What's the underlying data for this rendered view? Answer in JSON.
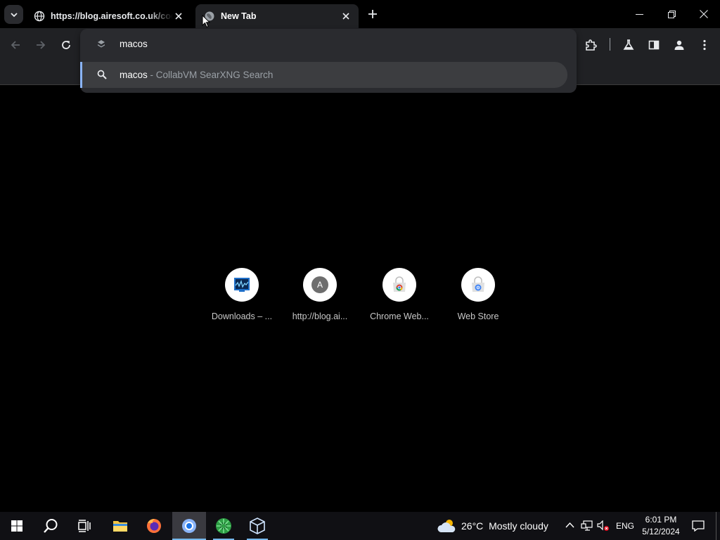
{
  "tabs": [
    {
      "title": "https://blog.airesoft.co.uk/code/",
      "active": false
    },
    {
      "title": "New Tab",
      "active": true
    }
  ],
  "omnibox": {
    "input_text": "macos",
    "suggestion": {
      "query": "macos",
      "separator": " - ",
      "engine": "CollabVM SearXNG Search"
    }
  },
  "shortcuts": [
    {
      "label": "Downloads – ...",
      "icon": "monitor-chart-icon"
    },
    {
      "label": "http://blog.ai...",
      "icon": "letter-a-icon",
      "letter": "A"
    },
    {
      "label": "Chrome Web...",
      "icon": "chrome-web-store-icon"
    },
    {
      "label": "Web Store",
      "icon": "chrome-web-store-icon"
    }
  ],
  "taskbar": {
    "weather": {
      "temp": "26°C",
      "condition": "Mostly cloudy"
    },
    "language": "ENG",
    "time": "6:01 PM",
    "date": "5/12/2024"
  },
  "colors": {
    "accent": "#8ab4f8",
    "taskbar_indicator": "#76b9ed",
    "toolbar_bg": "#202124"
  }
}
